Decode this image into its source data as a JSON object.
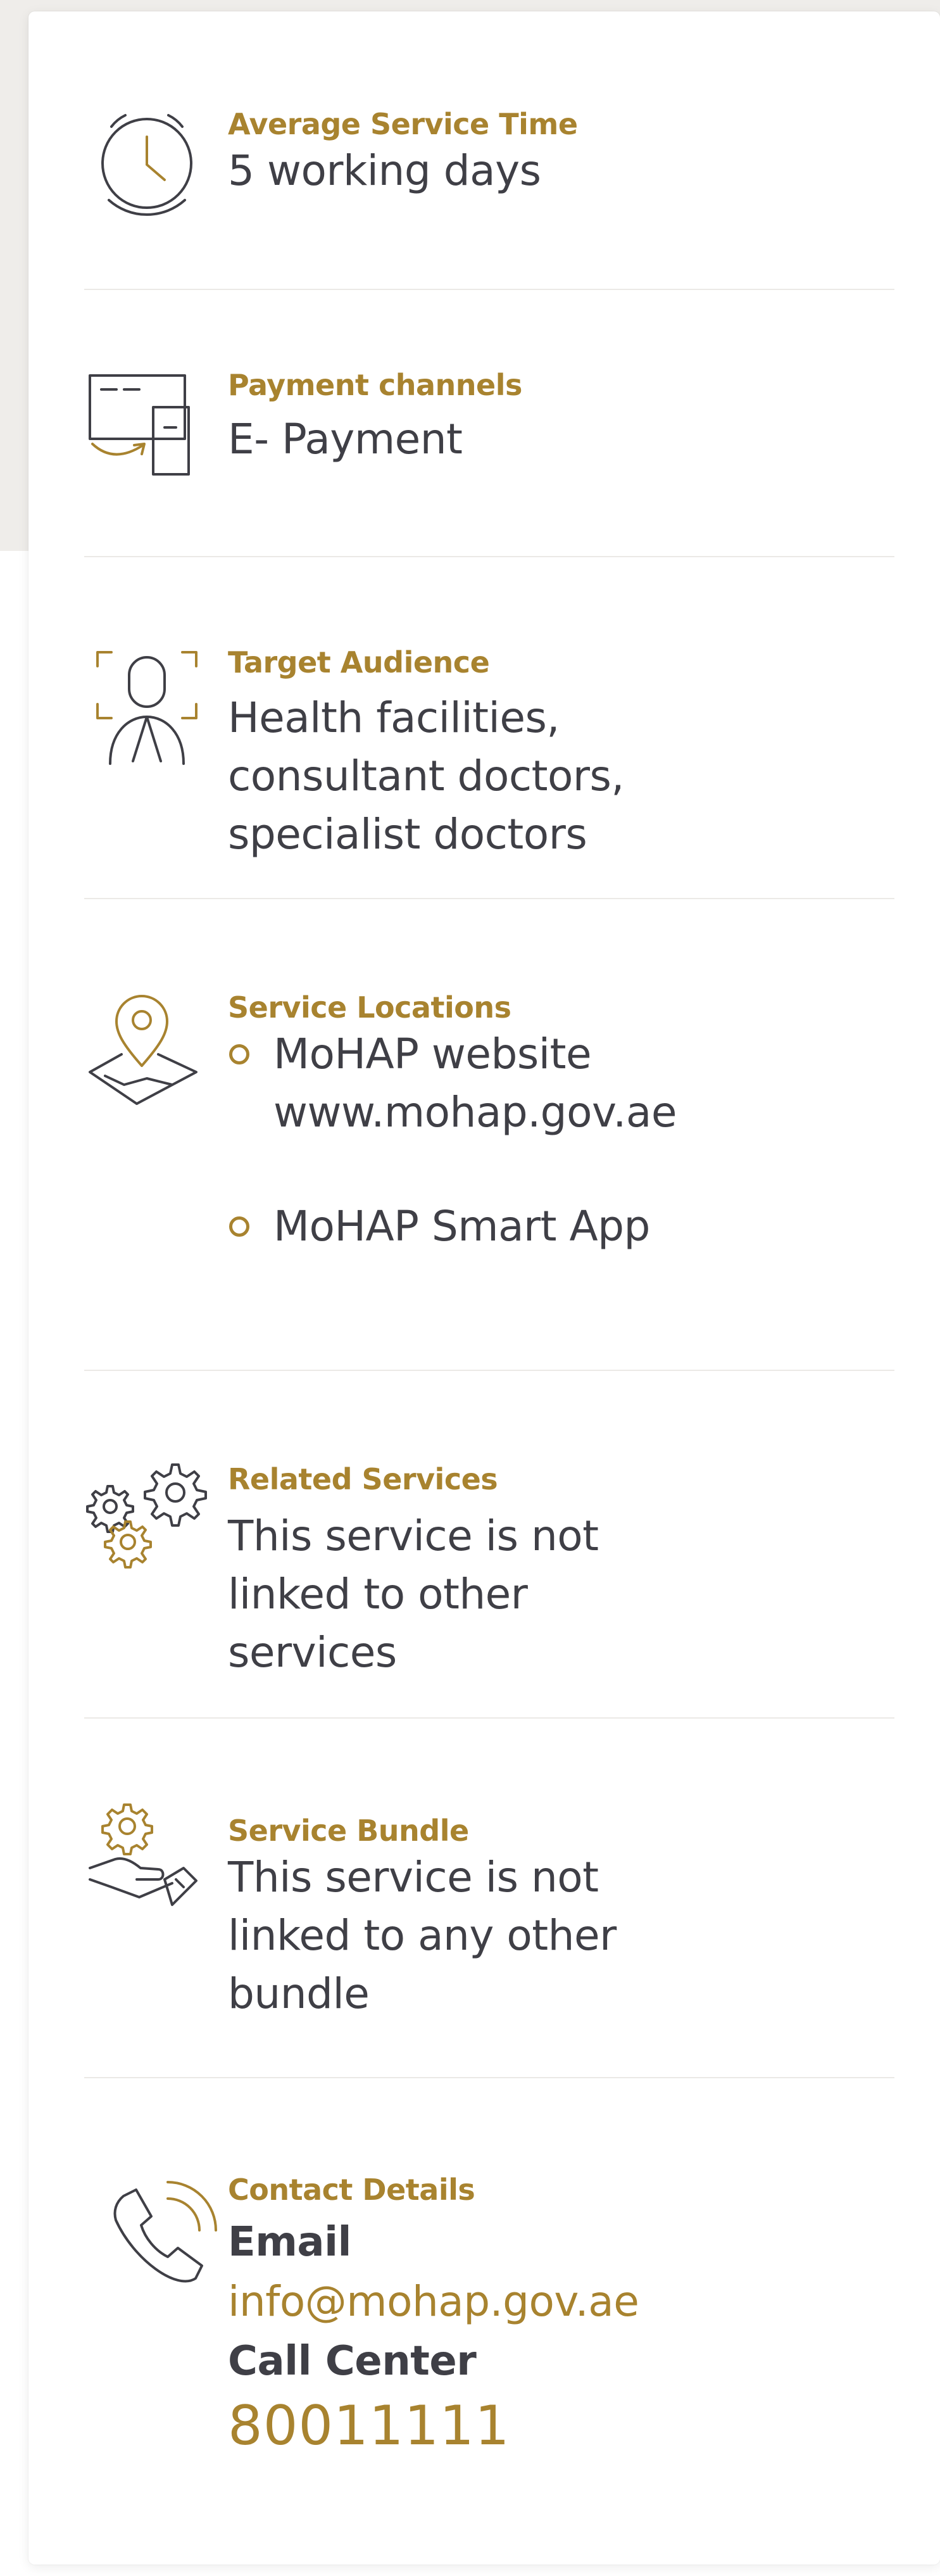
{
  "sections": {
    "time": {
      "label": "Average Service Time",
      "value": "5 working days",
      "icon": "clock-icon"
    },
    "payment": {
      "label": "Payment channels",
      "value": "E- Payment",
      "icon": "payment-icon"
    },
    "audience": {
      "label": "Target Audience",
      "value": "Health facilities, consultant doctors, specialist doctors",
      "icon": "person-scan-icon"
    },
    "locations": {
      "label": "Service Locations",
      "icon": "map-pin-icon",
      "items": [
        {
          "title": "MoHAP website",
          "detail": "www.mohap.gov.ae"
        },
        {
          "title": "MoHAP Smart App"
        }
      ]
    },
    "related": {
      "label": "Related Services",
      "value": "This service is not linked to other services",
      "icon": "gears-icon"
    },
    "bundle": {
      "label": "Service Bundle",
      "value": "This service is not linked to any other bundle",
      "icon": "hand-gear-icon"
    },
    "contact": {
      "label": "Contact Details",
      "icon": "phone-icon",
      "email_label": "Email",
      "email": "info@mohap.gov.ae",
      "call_label": "Call Center",
      "phone": "80011111"
    }
  },
  "colors": {
    "accent": "#a8832f",
    "text": "#3f3f46",
    "divider": "#ebe9e6",
    "background": "#efedea"
  }
}
